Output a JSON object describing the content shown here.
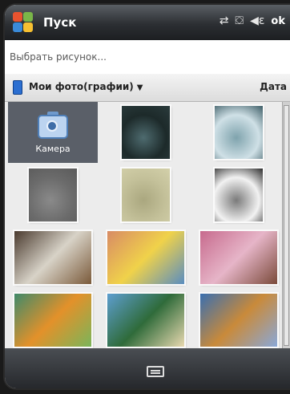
{
  "status_bar": {
    "title": "Пуск",
    "icons": [
      "connectivity-icon",
      "sync-icon",
      "volume-icon"
    ],
    "ok_label": "ok"
  },
  "prompt": "Выбрать рисунок...",
  "folder": {
    "label": "Мои фото(графии)",
    "sort_label": "Дата"
  },
  "grid": {
    "items": [
      {
        "type": "camera",
        "label": "Камера",
        "selected": true
      },
      {
        "type": "texture",
        "colors": [
          "#1d2a2a",
          "#4e6b6f",
          "#2a3b3c"
        ]
      },
      {
        "type": "texture",
        "colors": [
          "#cfe0e6",
          "#7fa3ad",
          "#3d5d66"
        ]
      },
      {
        "type": "texture",
        "colors": [
          "#6b6b6b",
          "#8a8a8a",
          "#5a5a5a"
        ]
      },
      {
        "type": "texture",
        "colors": [
          "#c4c19a",
          "#aaa77f",
          "#d3d0aa"
        ]
      },
      {
        "type": "texture",
        "colors": [
          "#f2f2f2",
          "#7a7a7a",
          "#2c2c2c"
        ]
      },
      {
        "type": "photo",
        "colors": [
          "#4a3a2e",
          "#d8d3c8",
          "#7a5a3a"
        ]
      },
      {
        "type": "photo",
        "colors": [
          "#d88b65",
          "#f0d24a",
          "#5a8dc0"
        ]
      },
      {
        "type": "photo",
        "colors": [
          "#c76a8d",
          "#e6b5c8",
          "#7a4a3a"
        ]
      },
      {
        "type": "photo",
        "colors": [
          "#3f8a6a",
          "#e3912a",
          "#7ab55a"
        ]
      },
      {
        "type": "photo",
        "colors": [
          "#5d9ed0",
          "#2f6b3a",
          "#e8d9b0"
        ]
      },
      {
        "type": "photo",
        "colors": [
          "#3a6fb0",
          "#c98a3a",
          "#8aa8d8"
        ]
      }
    ]
  },
  "colors": {
    "status_bar": "#2c2f33",
    "selection": "#5a5f68",
    "accent": "#2c6fd1"
  }
}
